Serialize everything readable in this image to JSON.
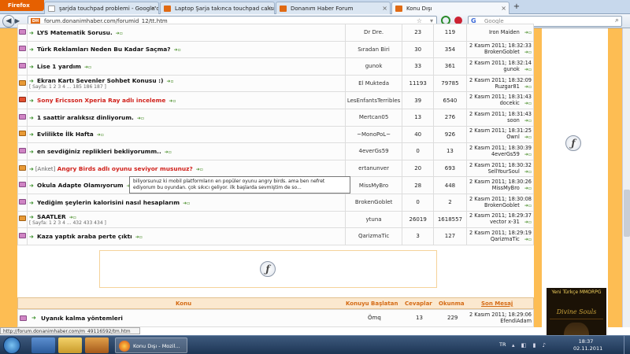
{
  "browser": {
    "app_button": "Firefox",
    "tabs": [
      {
        "label": "şarjda touchpad problemi - Google'd...",
        "icon": "google-icon",
        "active": false
      },
      {
        "label": "Laptop Şarja takınca touchpad calısm...",
        "icon": "dh-icon",
        "active": false
      },
      {
        "label": "Donanım Haber Forum",
        "icon": "dh-icon",
        "active": false
      },
      {
        "label": "Konu Dışı",
        "icon": "dh-icon",
        "active": true
      }
    ],
    "new_tab": "+",
    "url": "forum.donanimhaber.com/forumid_12/tt.htm",
    "search_placeholder": "Google"
  },
  "topics": [
    {
      "title": "LYS Matematik Sorusu.",
      "red": false,
      "prefix": "",
      "pager": "",
      "icon": "normal",
      "starter": "Dr Dre.",
      "replies": "23",
      "views": "119",
      "last_time": "",
      "last_user": "Iron Maiden"
    },
    {
      "title": "Türk Reklamları Neden Bu Kadar Saçma?",
      "red": false,
      "prefix": "",
      "pager": "",
      "icon": "normal",
      "starter": "Sıradan Biri",
      "replies": "30",
      "views": "354",
      "last_time": "2 Kasım 2011; 18:32:33",
      "last_user": "BrokenGoblet"
    },
    {
      "title": "Lise 1 yardım",
      "red": false,
      "prefix": "",
      "pager": "",
      "icon": "normal",
      "starter": "gunok",
      "replies": "33",
      "views": "361",
      "last_time": "2 Kasım 2011; 18:32:14",
      "last_user": "gunok"
    },
    {
      "title": "Ekran Kartı Sevenler Sohbet Konusu :)",
      "red": false,
      "prefix": "",
      "pager": "[ Sayfa: 1 2 3 4 ... 185 186 187 ]",
      "icon": "hot",
      "starter": "El Mukteda",
      "replies": "11193",
      "views": "79785",
      "last_time": "2 Kasım 2011; 18:32:09",
      "last_user": "Ruzgar81"
    },
    {
      "title": "Sony Ericsson Xperia Ray adlı inceleme",
      "red": true,
      "prefix": "",
      "pager": "",
      "icon": "new",
      "starter": "LesEnfantsTerribles",
      "replies": "39",
      "views": "6540",
      "last_time": "2 Kasım 2011; 18:31:43",
      "last_user": "docekic"
    },
    {
      "title": "1 saattir aralıksız dinliyorum.",
      "red": false,
      "prefix": "",
      "pager": "",
      "icon": "normal",
      "starter": "Mertcan05",
      "replies": "13",
      "views": "276",
      "last_time": "2 Kasım 2011; 18:31:43",
      "last_user": "soon"
    },
    {
      "title": "Evlilikte İlk Hafta",
      "red": false,
      "prefix": "",
      "pager": "",
      "icon": "hot",
      "starter": "~MonoPoL~",
      "replies": "40",
      "views": "926",
      "last_time": "2 Kasım 2011; 18:31:25",
      "last_user": "Ownl"
    },
    {
      "title": "en sevdiğiniz replikleri bekliyorumm..",
      "red": false,
      "prefix": "",
      "pager": "",
      "icon": "normal",
      "starter": "4everGs59",
      "replies": "0",
      "views": "13",
      "last_time": "2 Kasım 2011; 18:30:39",
      "last_user": "4everGs59"
    },
    {
      "title": "Angry Birds adlı oyunu seviyor musunuz?",
      "red": true,
      "prefix": "[Anket]",
      "pager": "",
      "icon": "hot",
      "starter": "ertanunver",
      "replies": "20",
      "views": "693",
      "last_time": "2 Kasım 2011; 18:30:32",
      "last_user": "SellYourSoul"
    },
    {
      "title": "Okula Adapte Olamıyorum",
      "red": false,
      "prefix": "",
      "pager": "",
      "icon": "normal",
      "starter": "MissMyBro",
      "replies": "28",
      "views": "448",
      "last_time": "2 Kasım 2011; 18:30:26",
      "last_user": "MissMyBro"
    },
    {
      "title": "Yediğim şeylerin kalorisini nasıl hesaplarım",
      "red": false,
      "prefix": "",
      "pager": "",
      "icon": "normal",
      "starter": "BrokenGoblet",
      "replies": "0",
      "views": "2",
      "last_time": "2 Kasım 2011; 18:30:08",
      "last_user": "BrokenGoblet"
    },
    {
      "title": "SAATLER",
      "red": false,
      "prefix": "",
      "pager": "[ Sayfa: 1 2 3 4 ... 432 433 434 ]",
      "icon": "hot",
      "starter": "ytuna",
      "replies": "26019",
      "views": "1618557",
      "last_time": "2 Kasım 2011; 18:29:37",
      "last_user": "vector x-31"
    },
    {
      "title": "Kaza yaptık araba perte çıktı",
      "red": false,
      "prefix": "",
      "pager": "",
      "icon": "normal",
      "starter": "QarizmaTic",
      "replies": "3",
      "views": "127",
      "last_time": "2 Kasım 2011; 18:29:19",
      "last_user": "QarizmaTic"
    }
  ],
  "tooltip": "biliyorsunuz ki mobil platformların en popüler oyunu angry birds. ama ben nefret ediyorum bu oyundan. çok sıkıcı geliyor. ilk başlarda sevmiştim de so...",
  "header": {
    "topic": "Konu",
    "starter": "Konuyu Başlatan",
    "replies": "Cevaplar",
    "views": "Okunma",
    "last": "Son Mesaj"
  },
  "bottom_topic": {
    "title": "Uyanık kalma yöntemleri",
    "starter": "Ömq",
    "replies": "13",
    "views": "229",
    "last_time": "2 Kasım 2011; 18:29:06",
    "last_user": "EfendiAdam"
  },
  "right_ad": {
    "line1": "Yeni Türkçe MMORPG",
    "logo": "Divine Souls"
  },
  "status_url": "http://forum.donanimhaber.com/m_49116592/tm.htm",
  "taskbar": {
    "ff_label": "Konu Dışı - Mozil...",
    "lang": "TR",
    "time": "18:37",
    "date": "02.11.2011"
  },
  "colors": {
    "page_bg": "#fdbd53",
    "header_text": "#d46a14",
    "red_title": "#d0201a",
    "firefox": "#e66000"
  }
}
